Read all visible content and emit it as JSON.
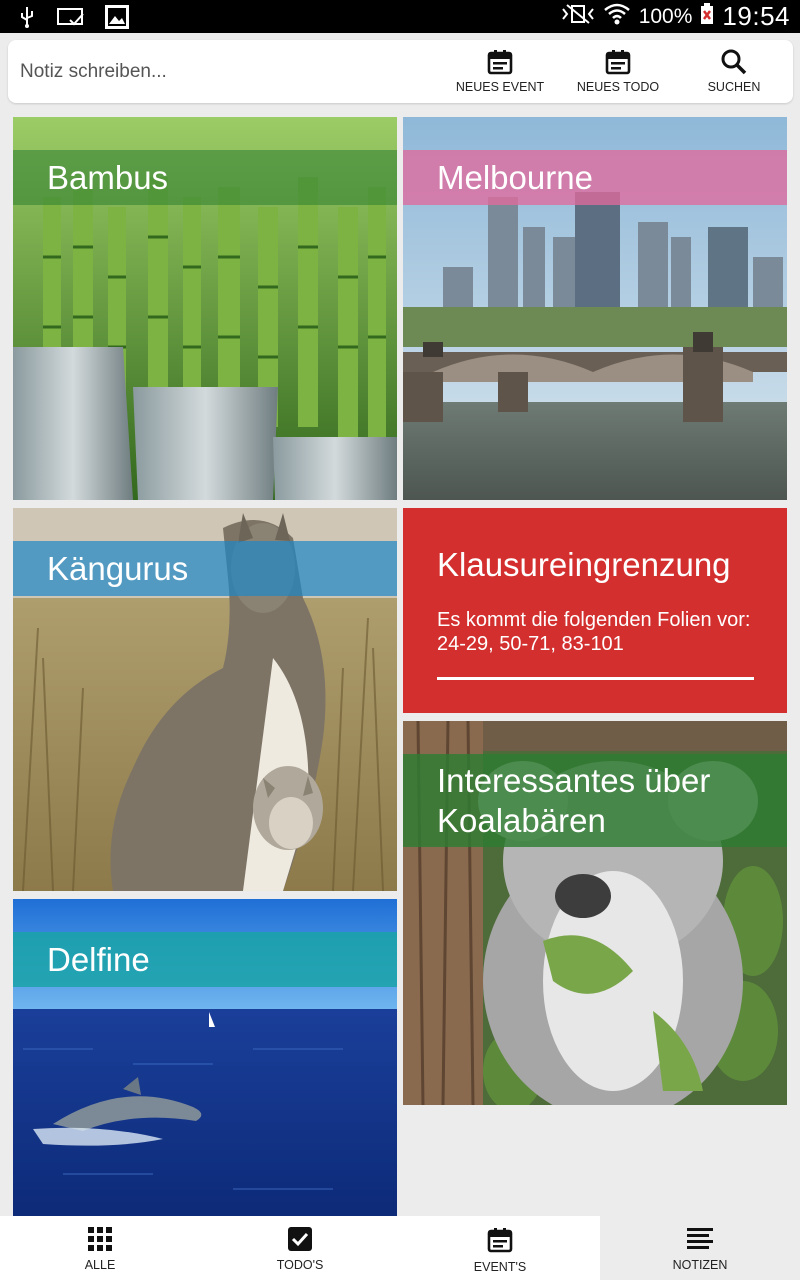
{
  "status_bar": {
    "battery": "100%",
    "time": "19:54",
    "icons": [
      "usb-icon",
      "cast-icon",
      "image-icon",
      "vibrate-icon",
      "wifi-icon",
      "battery-icon"
    ]
  },
  "top_bar": {
    "note_placeholder": "Notiz schreiben...",
    "actions": [
      {
        "label": "NEUES EVENT",
        "icon": "calendar-icon"
      },
      {
        "label": "NEUES TODO",
        "icon": "calendar-icon"
      },
      {
        "label": "SUCHEN",
        "icon": "search-icon"
      }
    ]
  },
  "tiles": [
    {
      "title": "Bambus",
      "banner_color": "#2e7d32"
    },
    {
      "title": "Melbourne",
      "banner_color": "#e06a9e"
    },
    {
      "title": "Kängurus",
      "banner_color": "#1e88c8"
    },
    {
      "title": "Klausureingrenzung",
      "body": "Es kommt die folgenden Folien vor: 24-29, 50-71, 83-101",
      "color": "#d32f2f"
    },
    {
      "title": "Interessantes über Koalabären",
      "banner_color": "#2e7d32"
    },
    {
      "title": "Delfine",
      "banner_color": "#1aa3a8"
    }
  ],
  "bottom_nav": [
    {
      "label": "ALLE",
      "icon": "grid-icon"
    },
    {
      "label": "TODO'S",
      "icon": "checkbox-icon"
    },
    {
      "label": "EVENT'S",
      "icon": "calendar-icon"
    },
    {
      "label": "NOTIZEN",
      "icon": "notes-icon",
      "active": true
    }
  ]
}
